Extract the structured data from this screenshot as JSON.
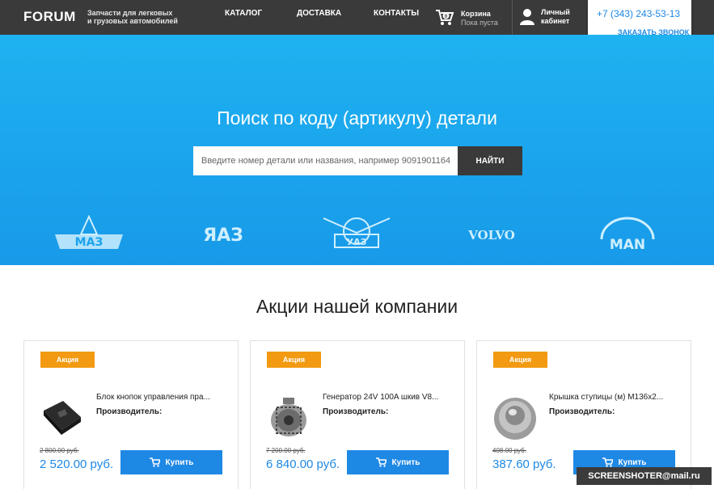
{
  "header": {
    "logo": "FORUM",
    "tagline_line1": "Запчасти для легковых",
    "tagline_line2": "и грузовых автомобилей",
    "nav": [
      "КАТАЛОГ",
      "ДОСТАВКА",
      "КОНТАКТЫ"
    ],
    "cart": {
      "count": "0",
      "title": "Корзина",
      "status": "Пока пуста"
    },
    "account": {
      "line1": "Личный",
      "line2": "кабинет"
    },
    "phone": "+7 (343) 243-53-13",
    "callback": "ЗАКАЗАТЬ ЗВОНОК"
  },
  "hero": {
    "title": "Поиск по коду (артикулу) детали",
    "search_placeholder": "Введите номер детали или названия, например 9091901164",
    "search_button": "НАЙТИ",
    "brands": [
      "МАЗ",
      "ЯАЗ",
      "УАЗ",
      "VOLVO",
      "MAN"
    ]
  },
  "promo": {
    "title": "Акции нашей компании",
    "badge": "Акция",
    "maker_label": "Производитель:",
    "buy_label": "Купить",
    "products": [
      {
        "name": "Блок кнопок управления пра...",
        "old_price": "2 800.00 руб.",
        "price": "2 520.00 руб.",
        "image": "switch-block-icon"
      },
      {
        "name": "Генератор 24V 100A шкив V8...",
        "old_price": "7 200.00 руб.",
        "price": "6 840.00 руб.",
        "image": "generator-icon"
      },
      {
        "name": "Крышка ступицы (м) М136х2...",
        "old_price": "408.00 руб.",
        "price": "387.60 руб.",
        "image": "hub-cap-icon"
      }
    ]
  },
  "watermark": "SCREENSHOTER@mail.ru",
  "colors": {
    "header_bg": "#3a3a3a",
    "hero_bg": "#1aa3ec",
    "accent": "#1e88e5",
    "badge": "#f29a11"
  }
}
